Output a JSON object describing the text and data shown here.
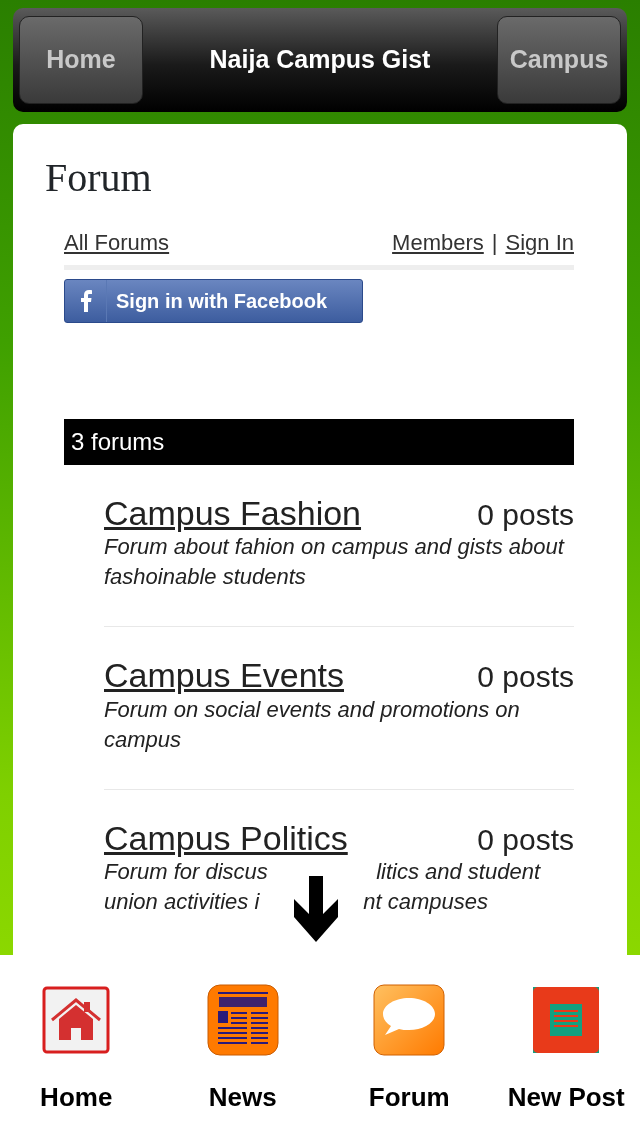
{
  "header": {
    "left_button": "Home",
    "title": "Naija Campus Gist",
    "right_button": "Campus"
  },
  "page_title": "Forum",
  "links": {
    "all_forums": "All Forums",
    "members": "Members",
    "separator": "|",
    "sign_in": "Sign In"
  },
  "facebook_button": "Sign in with Facebook",
  "forums_bar": "3 forums",
  "forums": [
    {
      "title": "Campus Fashion",
      "posts": "0 posts",
      "description": "Forum about fahion on campus and gists about fashoinable students"
    },
    {
      "title": "Campus Events",
      "posts": "0 posts",
      "description": "Forum on social events and promotions on campus"
    },
    {
      "title": "Campus Politics",
      "posts": "0 posts",
      "description_fragments": [
        [
          "Forum for discus",
          "litics and student"
        ],
        [
          "union activities i",
          "nt campuses"
        ]
      ]
    }
  ],
  "tab_bar": [
    {
      "kind": "home",
      "label": "Home"
    },
    {
      "kind": "news",
      "label": "News"
    },
    {
      "kind": "forum",
      "label": "Forum"
    },
    {
      "kind": "newpost",
      "label": "New Post"
    }
  ]
}
